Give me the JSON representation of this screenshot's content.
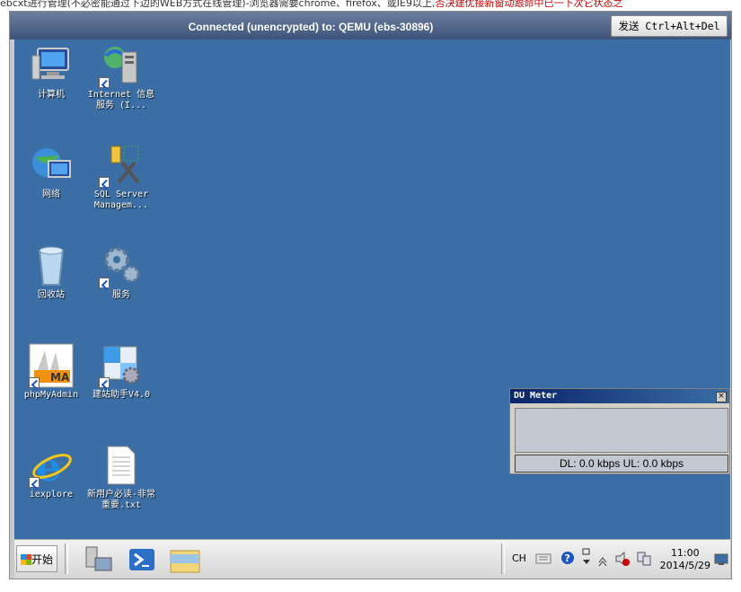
{
  "top_strip": {
    "text": "ebcxt进行管理(不必密能通过下边的WEB方式在线管理)-浏览器需要chrome、firefox、或IE9以上,",
    "red_text": "否决建优接新窗动跟命中已一下次它状态之"
  },
  "vnc": {
    "title": "Connected (unencrypted) to: QEMU (ebs-30896)",
    "cad_label": "发送 Ctrl+Alt+Del"
  },
  "desktop_icons": [
    {
      "label": "计算机"
    },
    {
      "label": "Internet 信息服务 (I..."
    },
    {
      "label": "网络"
    },
    {
      "label": "SQL Server Managem..."
    },
    {
      "label": "回收站"
    },
    {
      "label": "服务"
    },
    {
      "label": "phpMyAdmin"
    },
    {
      "label": "建站助手V4.0"
    },
    {
      "label": "iexplore"
    },
    {
      "label": "新用户必读-非常重要.txt"
    }
  ],
  "taskbar": {
    "start_label": "开始",
    "tray_lang": "CH",
    "time": "11:00",
    "date": "2014/5/29"
  },
  "du_meter": {
    "title": "DU Meter",
    "readout": "DL: 0.0 kbps  UL: 0.0 kbps"
  },
  "colors": {
    "desktop_bg": "#3a6ea5",
    "title_bg": "#4a5f84",
    "error_red": "#d40000"
  }
}
